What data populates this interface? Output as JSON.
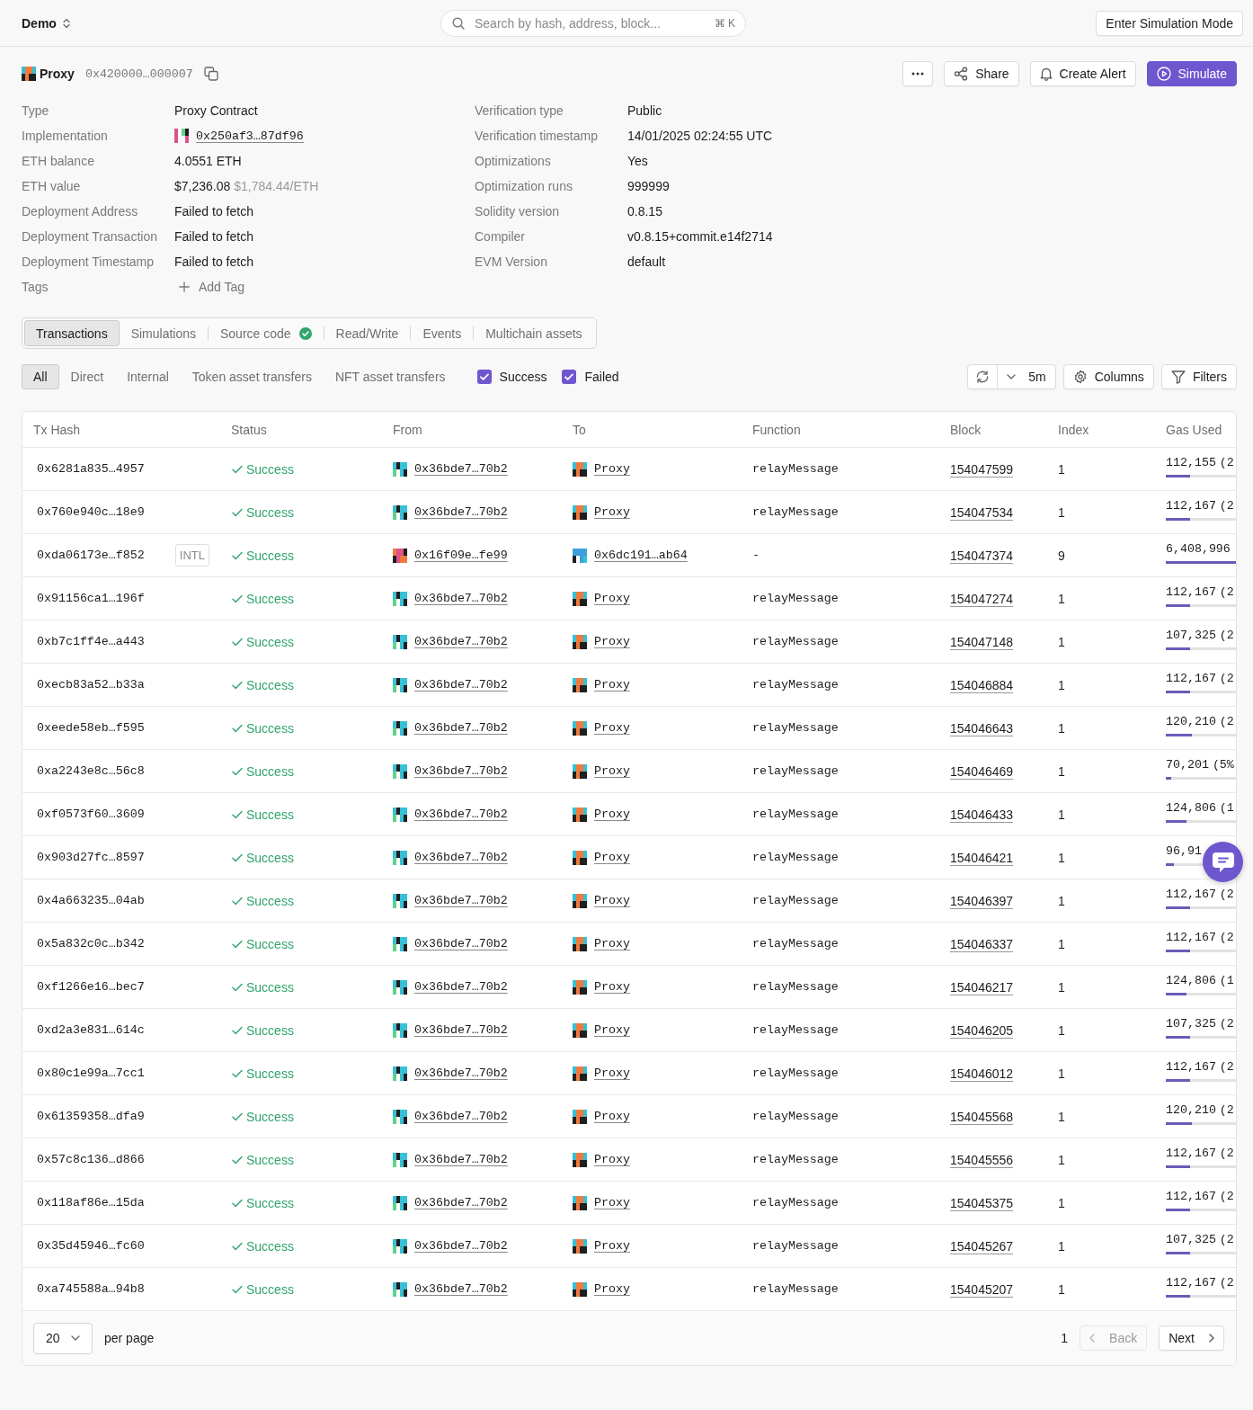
{
  "top_bar": {
    "workspace": "Demo",
    "search": {
      "placeholder": "Search by hash, address, block...",
      "shortcut": "⌘ K"
    },
    "mode_button": "Enter Simulation Mode"
  },
  "contract": {
    "name": "Proxy",
    "address": "0x420000…000007",
    "actions": [
      {
        "kind": "more"
      },
      {
        "kind": "share",
        "label": "Share"
      },
      {
        "kind": "alert",
        "label": "Create Alert"
      },
      {
        "kind": "simulate",
        "label": "Simulate"
      }
    ]
  },
  "details": {
    "left": [
      {
        "kind": "text",
        "label": "Type",
        "value": "Proxy Contract"
      },
      {
        "kind": "address",
        "label": "Implementation",
        "value": "0x250af3…87df96"
      },
      {
        "kind": "text",
        "label": "ETH balance",
        "value": "4.0551 ETH"
      },
      {
        "kind": "price",
        "label": "ETH value",
        "value": "$7,236.08",
        "note": "$1,784.44/ETH"
      },
      {
        "kind": "text",
        "label": "Deployment Address",
        "value": "Failed to fetch"
      },
      {
        "kind": "text",
        "label": "Deployment Transaction",
        "value": "Failed to fetch"
      },
      {
        "kind": "text",
        "label": "Deployment Timestamp",
        "value": "Failed to fetch"
      },
      {
        "kind": "action",
        "label": "Tags",
        "value": "Add Tag"
      }
    ],
    "right": [
      {
        "kind": "text",
        "label": "Verification type",
        "value": "Public"
      },
      {
        "kind": "text",
        "label": "Verification timestamp",
        "value": "14/01/2025 02:24:55 UTC"
      },
      {
        "kind": "text",
        "label": "Optimizations",
        "value": "Yes"
      },
      {
        "kind": "text",
        "label": "Optimization runs",
        "value": "999999"
      },
      {
        "kind": "text",
        "label": "Solidity version",
        "value": "0.8.15"
      },
      {
        "kind": "text",
        "label": "Compiler",
        "value": "v0.8.15+commit.e14f2714"
      },
      {
        "kind": "text",
        "label": "EVM Version",
        "value": "default"
      }
    ]
  },
  "tabs": [
    {
      "label": "Transactions",
      "selected": true,
      "verified": false
    },
    {
      "label": "Simulations",
      "selected": false,
      "verified": false
    },
    {
      "label": "Source code",
      "selected": false,
      "verified": true
    },
    {
      "label": "Read/Write",
      "selected": false,
      "verified": false
    },
    {
      "label": "Events",
      "selected": false,
      "verified": false
    },
    {
      "label": "Multichain assets",
      "selected": false,
      "verified": false
    }
  ],
  "filters": {
    "scopes": [
      {
        "label": "All",
        "selected": true
      },
      {
        "label": "Direct",
        "selected": false
      },
      {
        "label": "Internal",
        "selected": false
      },
      {
        "label": "Token asset transfers",
        "selected": false
      },
      {
        "label": "NFT asset transfers",
        "selected": false
      }
    ],
    "status": [
      {
        "label": "Success",
        "checked": true
      },
      {
        "label": "Failed",
        "checked": true
      }
    ],
    "refresh_interval": "5m",
    "buttons": [
      {
        "kind": "columns",
        "label": "Columns"
      },
      {
        "kind": "filters",
        "label": "Filters"
      }
    ]
  },
  "table": {
    "columns": [
      "Tx Hash",
      "Status",
      "From",
      "To",
      "Function",
      "Block",
      "Index",
      "Gas Used"
    ],
    "rows": [
      {
        "hash": "0x6281a835…4957",
        "status": {
          "label": "Success",
          "kind": "success"
        },
        "from": "0x36bde7…70b2",
        "to": "Proxy",
        "function": "relayMessage",
        "block": "154047599",
        "index": "1",
        "gas_used": "112,155",
        "gas_share": "(2",
        "level": 0.35
      },
      {
        "hash": "0x760e940c…18e9",
        "status": {
          "label": "Success",
          "kind": "success"
        },
        "from": "0x36bde7…70b2",
        "to": "Proxy",
        "function": "relayMessage",
        "block": "154047534",
        "index": "1",
        "gas_used": "112,167",
        "gas_share": "(2",
        "level": 0.35
      },
      {
        "hash": "0xda06173e…f852",
        "tag": "INTL",
        "status": {
          "label": "Success",
          "kind": "success"
        },
        "from": "0x16f09e…fe99",
        "to": "0x6dc191…ab64",
        "function": "-",
        "block": "154047374",
        "index": "9",
        "gas_used": "6,408,996",
        "level": 1
      },
      {
        "hash": "0x91156ca1…196f",
        "status": {
          "label": "Success",
          "kind": "success"
        },
        "from": "0x36bde7…70b2",
        "to": "Proxy",
        "function": "relayMessage",
        "block": "154047274",
        "index": "1",
        "gas_used": "112,167",
        "gas_share": "(2",
        "level": 0.35
      },
      {
        "hash": "0xb7c1ff4e…a443",
        "status": {
          "label": "Success",
          "kind": "success"
        },
        "from": "0x36bde7…70b2",
        "to": "Proxy",
        "function": "relayMessage",
        "block": "154047148",
        "index": "1",
        "gas_used": "107,325",
        "gas_share": "(2",
        "level": 0.34
      },
      {
        "hash": "0xecb83a52…b33a",
        "status": {
          "label": "Success",
          "kind": "success"
        },
        "from": "0x36bde7…70b2",
        "to": "Proxy",
        "function": "relayMessage",
        "block": "154046884",
        "index": "1",
        "gas_used": "112,167",
        "gas_share": "(2",
        "level": 0.35
      },
      {
        "hash": "0xeede58eb…f595",
        "status": {
          "label": "Success",
          "kind": "success"
        },
        "from": "0x36bde7…70b2",
        "to": "Proxy",
        "function": "relayMessage",
        "block": "154046643",
        "index": "1",
        "gas_used": "120,210",
        "gas_share": "(2",
        "level": 0.37
      },
      {
        "hash": "0xa2243e8c…56c8",
        "status": {
          "label": "Success",
          "kind": "success"
        },
        "from": "0x36bde7…70b2",
        "to": "Proxy",
        "function": "relayMessage",
        "block": "154046469",
        "index": "1",
        "gas_used": "70,201",
        "gas_share": "(5%",
        "level": 0.08
      },
      {
        "hash": "0xf0573f60…3609",
        "status": {
          "label": "Success",
          "kind": "success"
        },
        "from": "0x36bde7…70b2",
        "to": "Proxy",
        "function": "relayMessage",
        "block": "154046433",
        "index": "1",
        "gas_used": "124,806",
        "gas_share": "(1",
        "level": 0.3
      },
      {
        "hash": "0x903d27fc…8597",
        "status": {
          "label": "Success",
          "kind": "success"
        },
        "from": "0x36bde7…70b2",
        "to": "Proxy",
        "function": "relayMessage",
        "block": "154046421",
        "index": "1",
        "gas_used": "96,91",
        "level": 0.11
      },
      {
        "hash": "0x4a663235…04ab",
        "status": {
          "label": "Success",
          "kind": "success"
        },
        "from": "0x36bde7…70b2",
        "to": "Proxy",
        "function": "relayMessage",
        "block": "154046397",
        "index": "1",
        "gas_used": "112,167",
        "gas_share": "(2",
        "level": 0.35
      },
      {
        "hash": "0x5a832c0c…b342",
        "status": {
          "label": "Success",
          "kind": "success"
        },
        "from": "0x36bde7…70b2",
        "to": "Proxy",
        "function": "relayMessage",
        "block": "154046337",
        "index": "1",
        "gas_used": "112,167",
        "gas_share": "(2",
        "level": 0.35
      },
      {
        "hash": "0xf1266e16…bec7",
        "status": {
          "label": "Success",
          "kind": "success"
        },
        "from": "0x36bde7…70b2",
        "to": "Proxy",
        "function": "relayMessage",
        "block": "154046217",
        "index": "1",
        "gas_used": "124,806",
        "gas_share": "(1",
        "level": 0.3
      },
      {
        "hash": "0xd2a3e831…614c",
        "status": {
          "label": "Success",
          "kind": "success"
        },
        "from": "0x36bde7…70b2",
        "to": "Proxy",
        "function": "relayMessage",
        "block": "154046205",
        "index": "1",
        "gas_used": "107,325",
        "gas_share": "(2",
        "level": 0.34
      },
      {
        "hash": "0x80c1e99a…7cc1",
        "status": {
          "label": "Success",
          "kind": "success"
        },
        "from": "0x36bde7…70b2",
        "to": "Proxy",
        "function": "relayMessage",
        "block": "154046012",
        "index": "1",
        "gas_used": "112,167",
        "gas_share": "(2",
        "level": 0.35
      },
      {
        "hash": "0x61359358…dfa9",
        "status": {
          "label": "Success",
          "kind": "success"
        },
        "from": "0x36bde7…70b2",
        "to": "Proxy",
        "function": "relayMessage",
        "block": "154045568",
        "index": "1",
        "gas_used": "120,210",
        "gas_share": "(2",
        "level": 0.37
      },
      {
        "hash": "0x57c8c136…d866",
        "status": {
          "label": "Success",
          "kind": "success"
        },
        "from": "0x36bde7…70b2",
        "to": "Proxy",
        "function": "relayMessage",
        "block": "154045556",
        "index": "1",
        "gas_used": "112,167",
        "gas_share": "(2",
        "level": 0.35
      },
      {
        "hash": "0x118af86e…15da",
        "status": {
          "label": "Success",
          "kind": "success"
        },
        "from": "0x36bde7…70b2",
        "to": "Proxy",
        "function": "relayMessage",
        "block": "154045375",
        "index": "1",
        "gas_used": "112,167",
        "gas_share": "(2",
        "level": 0.35
      },
      {
        "hash": "0x35d45946…fc60",
        "status": {
          "label": "Success",
          "kind": "success"
        },
        "from": "0x36bde7…70b2",
        "to": "Proxy",
        "function": "relayMessage",
        "block": "154045267",
        "index": "1",
        "gas_used": "107,325",
        "gas_share": "(2",
        "level": 0.34
      },
      {
        "hash": "0xa745588a…94b8",
        "status": {
          "label": "Success",
          "kind": "success"
        },
        "from": "0x36bde7…70b2",
        "to": "Proxy",
        "function": "relayMessage",
        "block": "154045207",
        "index": "1",
        "gas_used": "112,167",
        "gas_share": "(2",
        "level": 0.35
      }
    ]
  },
  "pagination": {
    "page_size": "20",
    "page_size_label": "per page",
    "page": "1",
    "back": {
      "label": "Back",
      "disabled": true
    },
    "next": {
      "label": "Next",
      "disabled": false
    }
  }
}
